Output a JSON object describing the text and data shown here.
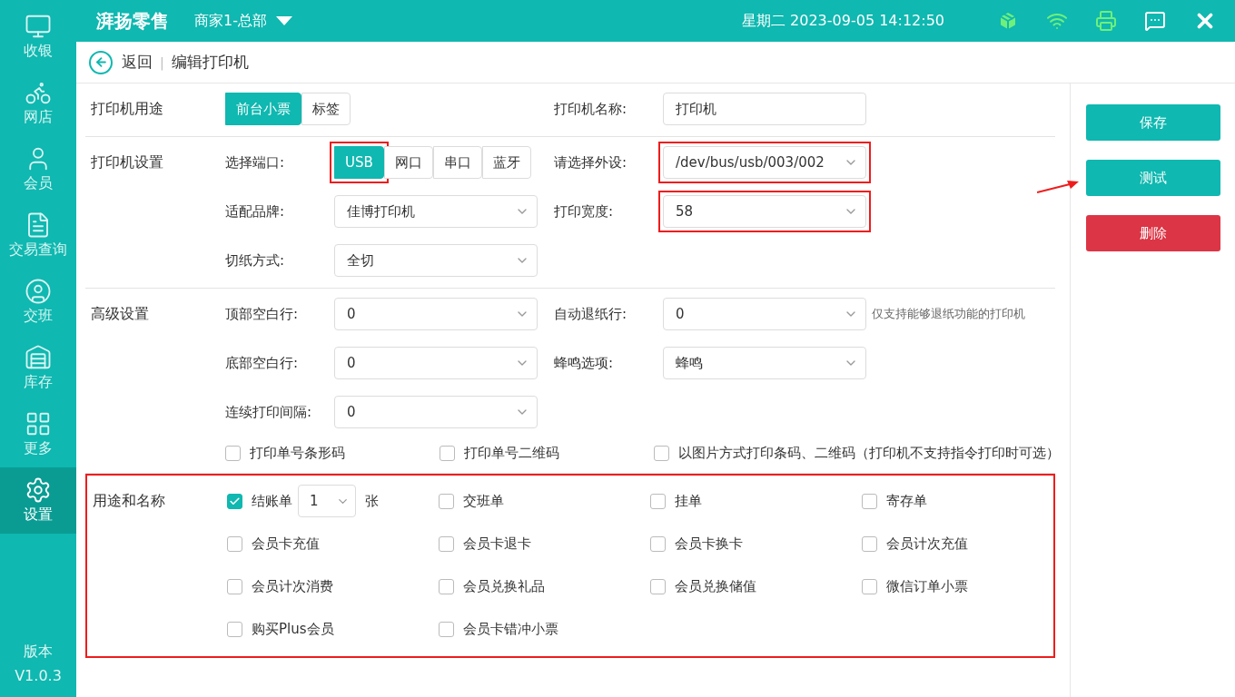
{
  "sidebar": {
    "items": [
      {
        "label": "收银",
        "selected": false
      },
      {
        "label": "网店",
        "selected": false
      },
      {
        "label": "会员",
        "selected": false
      },
      {
        "label": "交易查询",
        "selected": false
      },
      {
        "label": "交班",
        "selected": false
      },
      {
        "label": "库存",
        "selected": false
      },
      {
        "label": "更多",
        "selected": false
      },
      {
        "label": "设置",
        "selected": true
      }
    ],
    "version_label": "版本",
    "version": "V1.0.3"
  },
  "topbar": {
    "brand": "湃扬零售",
    "store": "商家1-总部",
    "datetime": "星期二 2023-09-05 14:12:50"
  },
  "header": {
    "back": "返回",
    "separator": "|",
    "title": "编辑打印机"
  },
  "sections": [
    {
      "title": "打印机用途",
      "annotated": false,
      "rows": [
        {
          "fields": [
            {
              "kind": "segmented",
              "options": [
                {
                  "label": "前台小票",
                  "selected": true,
                  "annotated": false
                },
                {
                  "label": "标签",
                  "selected": false,
                  "annotated": false
                }
              ]
            },
            {
              "kind": "input",
              "label": "打印机名称:",
              "value": "打印机",
              "annotated": false
            }
          ]
        }
      ]
    },
    {
      "title": "打印机设置",
      "annotated": false,
      "rows": [
        {
          "fields": [
            {
              "kind": "segmented",
              "label": "选择端口:",
              "options": [
                {
                  "label": "USB",
                  "selected": true,
                  "annotated": true
                },
                {
                  "label": "网口",
                  "selected": false,
                  "annotated": false
                },
                {
                  "label": "串口",
                  "selected": false,
                  "annotated": false
                },
                {
                  "label": "蓝牙",
                  "selected": false,
                  "annotated": false
                }
              ]
            },
            {
              "kind": "select",
              "label": "请选择外设:",
              "value": "/dev/bus/usb/003/002",
              "annotated": true
            }
          ]
        },
        {
          "fields": [
            {
              "kind": "select",
              "label": "适配品牌:",
              "value": "佳博打印机",
              "annotated": false
            },
            {
              "kind": "select",
              "label": "打印宽度:",
              "value": "58",
              "annotated": true
            }
          ]
        },
        {
          "fields": [
            {
              "kind": "select",
              "label": "切纸方式:",
              "value": "全切",
              "annotated": false
            }
          ]
        }
      ]
    },
    {
      "title": "高级设置",
      "annotated": false,
      "rows": [
        {
          "fields": [
            {
              "kind": "select",
              "label": "顶部空白行:",
              "value": "0",
              "annotated": false
            },
            {
              "kind": "select",
              "label": "自动退纸行:",
              "value": "0",
              "annotated": false
            }
          ],
          "note": "仅支持能够退纸功能的打印机"
        },
        {
          "fields": [
            {
              "kind": "select",
              "label": "底部空白行:",
              "value": "0",
              "annotated": false
            },
            {
              "kind": "select",
              "label": "蜂鸣选项:",
              "value": "蜂鸣",
              "annotated": false
            }
          ]
        },
        {
          "fields": [
            {
              "kind": "select",
              "label": "连续打印间隔:",
              "value": "0",
              "annotated": false
            }
          ]
        }
      ],
      "checkboxes": [
        {
          "label": "打印单号条形码",
          "checked": false
        },
        {
          "label": "打印单号二维码",
          "checked": false
        },
        {
          "label": "以图片方式打印条码、二维码（打印机不支持指令打印时可选）",
          "checked": false
        }
      ]
    },
    {
      "title": "用途和名称",
      "annotated": true,
      "purposes": [
        {
          "label": "结账单",
          "checked": true,
          "copies": "1",
          "unit": "张"
        },
        {
          "label": "交班单",
          "checked": false
        },
        {
          "label": "挂单",
          "checked": false
        },
        {
          "label": "寄存单",
          "checked": false
        },
        {
          "label": "会员卡充值",
          "checked": false
        },
        {
          "label": "会员卡退卡",
          "checked": false
        },
        {
          "label": "会员卡换卡",
          "checked": false
        },
        {
          "label": "会员计次充值",
          "checked": false
        },
        {
          "label": "会员计次消费",
          "checked": false
        },
        {
          "label": "会员兑换礼品",
          "checked": false
        },
        {
          "label": "会员兑换储值",
          "checked": false
        },
        {
          "label": "微信订单小票",
          "checked": false
        },
        {
          "label": "购买Plus会员",
          "checked": false
        },
        {
          "label": "会员卡错冲小票",
          "checked": false
        }
      ]
    }
  ],
  "actions": [
    {
      "label": "保存",
      "kind": "primary",
      "annotated": false
    },
    {
      "label": "测试",
      "kind": "primary",
      "annotated": true
    },
    {
      "label": "删除",
      "kind": "danger",
      "annotated": false
    }
  ]
}
